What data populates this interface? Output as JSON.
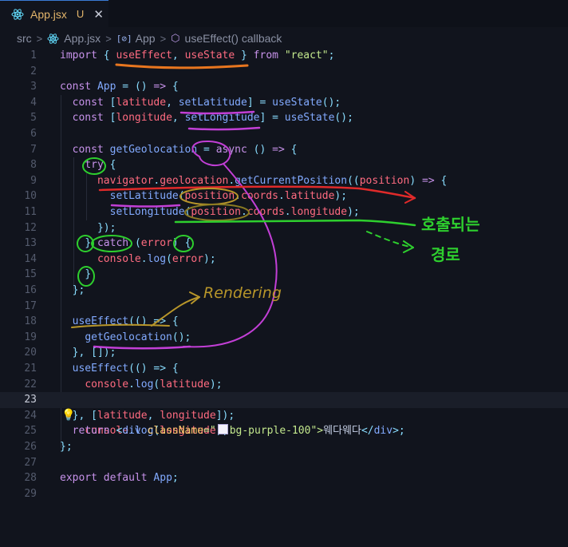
{
  "tab": {
    "filename": "App.jsx",
    "status": "U",
    "close": "✕"
  },
  "breadcrumb": {
    "folder": "src",
    "file": "App.jsx",
    "symbol": "App",
    "callback": "useEffect() callback"
  },
  "editor": {
    "line_numbers": [
      "1",
      "2",
      "3",
      "4",
      "5",
      "6",
      "7",
      "8",
      "9",
      "10",
      "11",
      "12",
      "13",
      "14",
      "15",
      "16",
      "17",
      "18",
      "19",
      "20",
      "21",
      "22",
      "23",
      "24",
      "25",
      "26",
      "27",
      "28",
      "29"
    ],
    "active_line": "23",
    "code": {
      "l1": [
        "import",
        "{",
        "useEffect",
        ",",
        "useState",
        "}",
        "from",
        "\"react\"",
        ";"
      ],
      "l3": [
        "const",
        "App",
        "=",
        "()",
        "=>",
        "{"
      ],
      "l4": [
        "const",
        "[",
        "latitude",
        ",",
        "setLatitude",
        "]",
        "=",
        "useState",
        "();"
      ],
      "l5": [
        "const",
        "[",
        "longitude",
        ",",
        "setLongitude",
        "]",
        "=",
        "useState",
        "();"
      ],
      "l7": [
        "const",
        "getGeolocation",
        "=",
        "async",
        "()",
        "=>",
        "{"
      ],
      "l8": [
        "try",
        "{"
      ],
      "l9": [
        "navigator",
        ".",
        "geolocation",
        ".",
        "getCurrentPosition",
        "((",
        "position",
        ")",
        "=>",
        "{"
      ],
      "l10": [
        "setLatitude",
        "(",
        "position",
        ".",
        "coords",
        ".",
        "latitude",
        ");"
      ],
      "l11": [
        "setLongitude",
        "(",
        "position",
        ".",
        "coords",
        ".",
        "longitude",
        ");"
      ],
      "l12": [
        "});"
      ],
      "l13": [
        "}",
        "catch",
        "(",
        "error",
        ")",
        "{"
      ],
      "l14": [
        "console",
        ".",
        "log",
        "(",
        "error",
        ");"
      ],
      "l15": [
        "}"
      ],
      "l16": [
        "};"
      ],
      "l18": [
        "useEffect",
        "(() =>",
        "{"
      ],
      "l19": [
        "getGeolocation",
        "();"
      ],
      "l20": [
        "},",
        "[]);"
      ],
      "l21": [
        "useEffect",
        "(() =>",
        "{"
      ],
      "l22": [
        "console",
        ".",
        "log",
        "(",
        "latitude",
        ");"
      ],
      "l23": [
        "console",
        ".",
        "log",
        "(",
        "longitude",
        ");"
      ],
      "l24": [
        "},",
        "[",
        "latitude",
        ",",
        "longitude",
        "]);"
      ],
      "l25": [
        "return",
        "<",
        "div",
        "className",
        "=\"",
        "bg-purple-100",
        "\">",
        "웨다웨다",
        "</",
        "div",
        ">;"
      ],
      "l26": [
        "};"
      ],
      "l28": [
        "export",
        "default",
        "App",
        ";"
      ]
    }
  },
  "annotations": {
    "rendering": "Rendering",
    "korean_note": "호출되는 경로"
  },
  "colors": {
    "orange": "#e8761f",
    "purple": "#c23fd6",
    "red": "#e02a2a",
    "green": "#2ecf2e",
    "gold": "#b8962a",
    "olive": "#8a7a22"
  }
}
